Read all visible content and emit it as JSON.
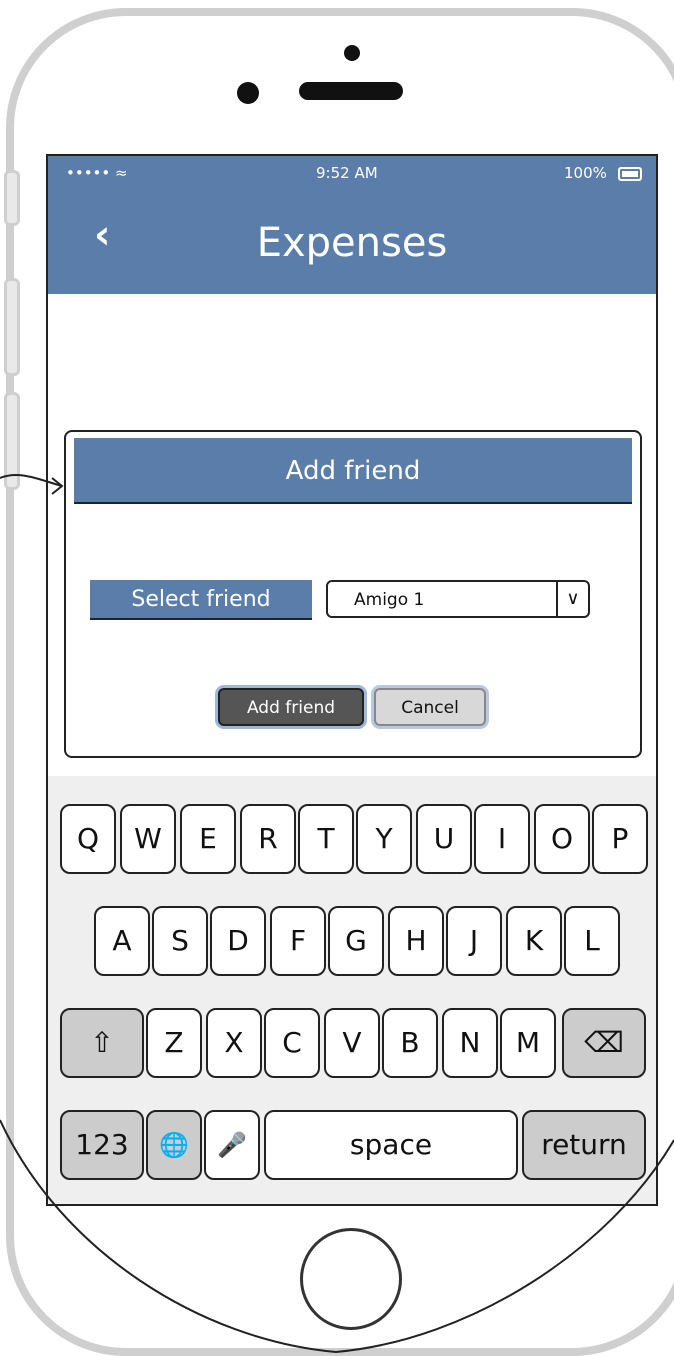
{
  "status_bar": {
    "carrier": "••••• ≈",
    "time": "9:52 AM",
    "battery": "100%"
  },
  "header": {
    "back_icon": "‹",
    "title": "Expenses"
  },
  "dialog": {
    "title": "Add friend",
    "select_label": "Select friend",
    "select_value": "Amigo 1",
    "select_arrow": "∨",
    "add_button": "Add friend",
    "cancel_button": "Cancel"
  },
  "keyboard": {
    "row1": [
      "Q",
      "W",
      "E",
      "R",
      "T",
      "Y",
      "U",
      "I",
      "O",
      "P"
    ],
    "row2": [
      "A",
      "S",
      "D",
      "F",
      "G",
      "H",
      "J",
      "K",
      "L"
    ],
    "row3": [
      "Z",
      "X",
      "C",
      "V",
      "B",
      "N",
      "M"
    ],
    "shift": "⇧",
    "backspace": "⌫",
    "numbers": "123",
    "globe": "🌐",
    "mic": "🎤",
    "space": "space",
    "return": "return"
  }
}
